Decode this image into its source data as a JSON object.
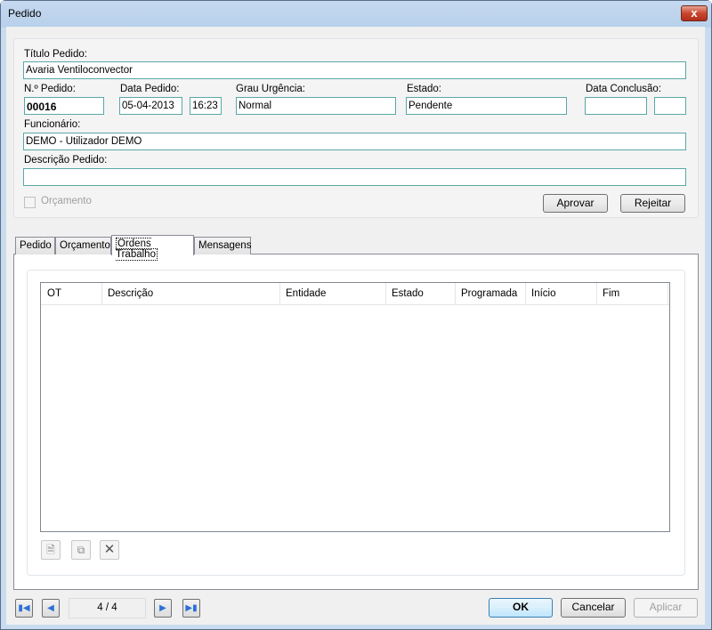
{
  "window": {
    "title": "Pedido",
    "close_label": "x"
  },
  "form": {
    "titulo_label": "Título Pedido:",
    "titulo_value": "Avaria Ventiloconvector",
    "numero_label": "N.º Pedido:",
    "numero_value": "00016",
    "data_label": "Data Pedido:",
    "data_value": "05-04-2013",
    "hora_value": "16:23",
    "urgencia_label": "Grau Urgência:",
    "urgencia_value": "Normal",
    "estado_label": "Estado:",
    "estado_value": "Pendente",
    "conclusao_label": "Data Conclusão:",
    "conclusao_date": "",
    "conclusao_time": "",
    "funcionario_label": "Funcionário:",
    "funcionario_value": "DEMO - Utilizador DEMO",
    "descricao_label": "Descrição Pedido:",
    "descricao_value": "",
    "orcamento_label": "Orçamento",
    "orcamento_checked": false,
    "aprovar": "Aprovar",
    "rejeitar": "Rejeitar"
  },
  "tabs": [
    {
      "label": "Pedido"
    },
    {
      "label": "Orçamento"
    },
    {
      "label": "Ordens Trabalho",
      "active": true
    },
    {
      "label": "Mensagens"
    }
  ],
  "grid": {
    "columns": [
      "OT",
      "Descrição",
      "Entidade",
      "Estado",
      "Programada",
      "Início",
      "Fim"
    ],
    "rows": []
  },
  "toolbar": {
    "new_icon": "new-document-icon",
    "copy_icon": "copy-document-icon",
    "delete_icon": "delete-x-icon"
  },
  "footer": {
    "counter": "4 / 4",
    "ok": "OK",
    "cancelar": "Cancelar",
    "aplicar": "Aplicar"
  }
}
